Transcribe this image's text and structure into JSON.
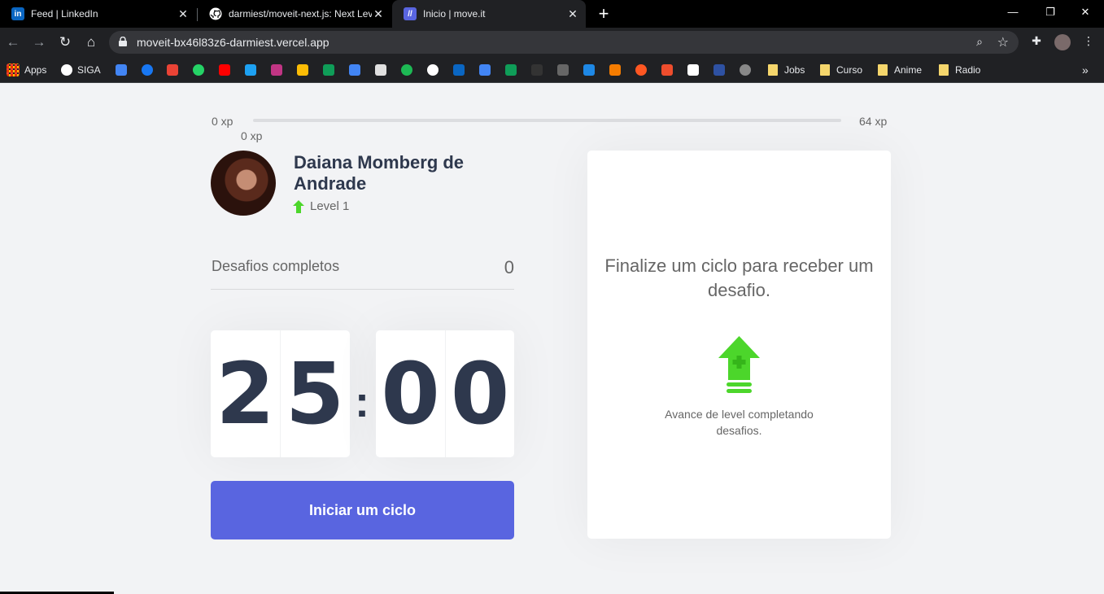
{
  "browser": {
    "tabs": [
      {
        "title": "Feed | LinkedIn",
        "icon": "linkedin-icon",
        "color": "#0a66c2"
      },
      {
        "title": "darmiest/moveit-next.js: Next Lev",
        "icon": "github-icon",
        "color": "#ffffff"
      },
      {
        "title": "Inicio | move.it",
        "icon": "moveit-icon",
        "color": "#5965e0"
      }
    ],
    "url": "moveit-bx46l83z6-darmiest.vercel.app",
    "bookmarks": {
      "apps": "Apps",
      "siga": "SIGA",
      "folders": [
        "Jobs",
        "Curso",
        "Anime",
        "Radio"
      ]
    }
  },
  "xp": {
    "start": "0 xp",
    "end": "64 xp",
    "current": "0 xp",
    "progress": 0
  },
  "profile": {
    "name": "Daiana Momberg de Andrade",
    "level": "Level 1"
  },
  "challenges": {
    "label": "Desafios completos",
    "count": "0"
  },
  "countdown": {
    "minute_left": "2",
    "minute_right": "5",
    "separator": ":",
    "second_left": "0",
    "second_right": "0"
  },
  "start_button": "Iniciar um ciclo",
  "challenge_box": {
    "heading": "Finalize um ciclo para receber um desafio.",
    "hint": "Avance de level completando desafios."
  },
  "colors": {
    "accent": "#5965e0",
    "green": "#4cd62b",
    "title": "#2e384d",
    "text": "#666666",
    "background": "#f2f3f5"
  }
}
